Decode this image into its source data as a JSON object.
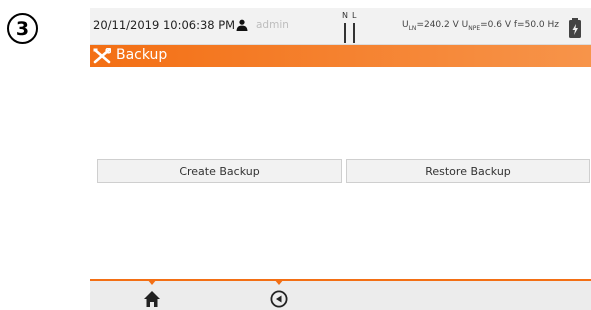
{
  "step": {
    "number": "3"
  },
  "status": {
    "datetime": "20/11/2019 10:06:38 PM",
    "user": "admin",
    "nl": {
      "n": "N",
      "l": "L"
    },
    "u_ln": {
      "prefix": "U",
      "sub": "LN",
      "value": "=240.2 V"
    },
    "u_npe": {
      "prefix": "U",
      "sub": "NPE",
      "value": "=0.6 V"
    },
    "frequency": "f=50.0 Hz"
  },
  "title": "Backup",
  "buttons": {
    "create": "Create Backup",
    "restore": "Restore Backup"
  },
  "colors": {
    "accent": "#f36f14",
    "status_bg": "#f2f2f2",
    "button_bg": "#f2f2f2"
  },
  "icons": {
    "user": "user-icon",
    "battery": "battery-icon",
    "tools": "tools-icon",
    "home": "home-icon",
    "back": "back-icon"
  }
}
